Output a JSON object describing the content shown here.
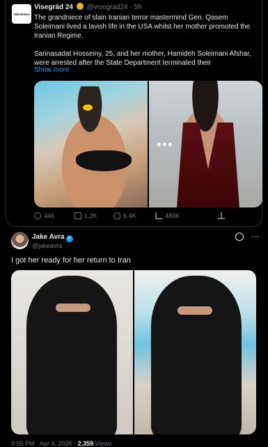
{
  "quoted": {
    "avatar_text": "VISEGRÁD24",
    "name": "Visegrád 24",
    "handle": "@visegrad24",
    "separator": "·",
    "time": "5h",
    "paragraph1": "The grandniece of slain Iranian terror mastermind Gen. Qasem Soleimani lived a lavish life in the USA whilst her mother promoted the Iranian Regime.",
    "paragraph2": "Sarinasadat Hosseiny, 25, and her mother, Hamideh Soleimani Afshar, were arrested after the State Department terminated their",
    "show_more": "Show more",
    "stats": {
      "replies": "446",
      "reposts": "1.2K",
      "likes": "6.4K",
      "views": "489K"
    }
  },
  "tweet": {
    "name": "Jake Avra",
    "handle": "@jakeavra",
    "text": "I got her ready for her return to Iran",
    "footer": {
      "time": "9:55 PM · Apr 4, 2026 ·",
      "views": "2,359",
      "views_label": "Views"
    }
  },
  "colors": {
    "background": "#000000",
    "accent": "#1d9bf0",
    "gold_badge": "#e2b719",
    "muted": "#71767b"
  },
  "icons": [
    "reply-icon",
    "repost-icon",
    "like-icon",
    "views-icon",
    "share-icon",
    "grok-icon",
    "more-icon",
    "verified-badge-icon"
  ]
}
